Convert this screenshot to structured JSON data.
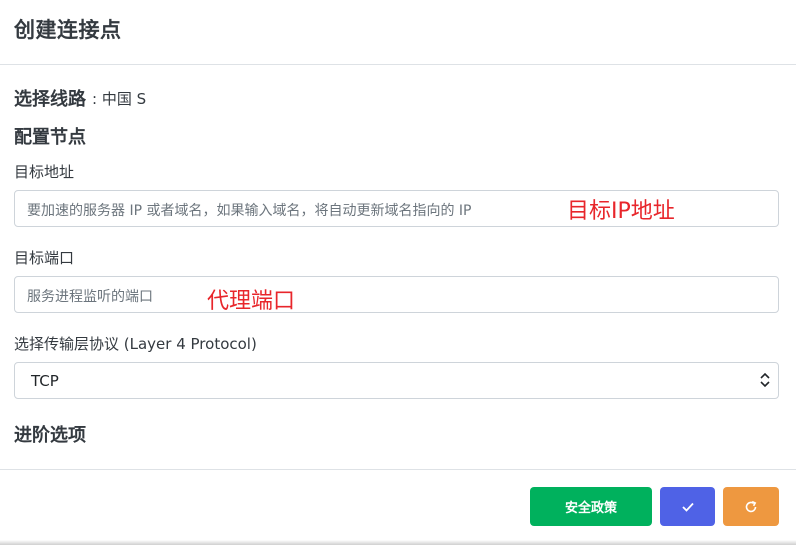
{
  "modal": {
    "title": "创建连接点"
  },
  "route": {
    "label": "选择线路",
    "value": ": 中国 S"
  },
  "sections": {
    "configure_node": "配置节点",
    "advanced_options": "进阶选项"
  },
  "target_address": {
    "label": "目标地址",
    "placeholder": "要加速的服务器 IP 或者域名，如果输入域名，将自动更新域名指向的 IP",
    "annotation": "目标IP地址"
  },
  "target_port": {
    "label": "目标端口",
    "placeholder": "服务进程监听的端口",
    "annotation": "代理端口"
  },
  "protocol": {
    "label": "选择传输层协议 (Layer 4 Protocol)",
    "selected": "TCP"
  },
  "footer": {
    "policy_button_label": "安全政策",
    "confirm_icon": "check-icon",
    "reset_icon": "refresh-icon"
  },
  "colors": {
    "policy_button": "#00b15d",
    "confirm_button": "#4f62e6",
    "reset_button": "#ee9840",
    "annotation": "#e8262b"
  }
}
